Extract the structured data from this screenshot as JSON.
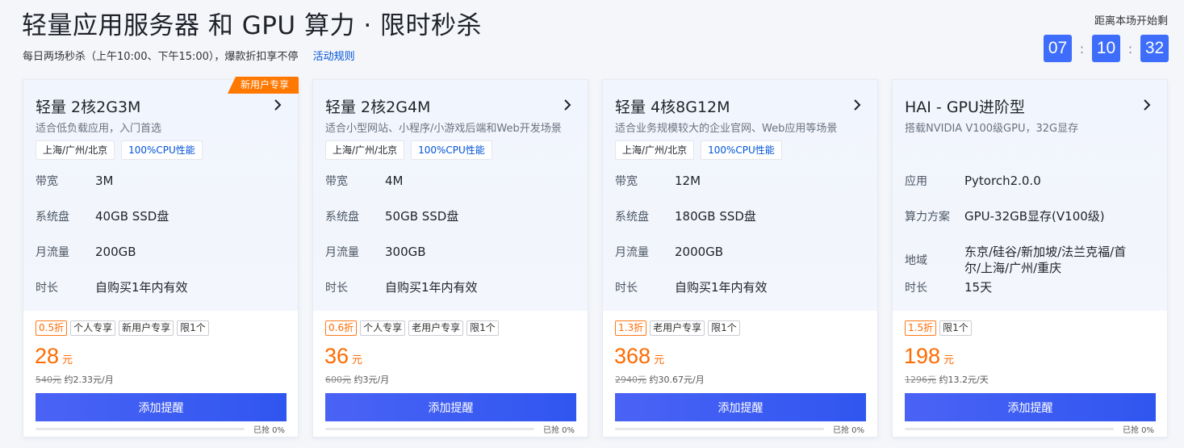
{
  "header": {
    "title": "轻量应用服务器 和 GPU 算力 · 限时秒杀",
    "subtitle": "每日两场秒杀（上午10:00、下午15:00），爆款折扣享不停",
    "rules_link": "活动规则"
  },
  "countdown": {
    "label": "距离本场开始剩",
    "hours": "07",
    "minutes": "10",
    "seconds": "32",
    "separator": ":",
    "accent_color": "#3d6dfa"
  },
  "cards": [
    {
      "badge": "新用户专享",
      "title": "轻量 2核2G3M",
      "desc": "适合低负载应用，入门首选",
      "tags": [
        "上海/广州/北京",
        "100%CPU性能"
      ],
      "specs": [
        {
          "label": "带宽",
          "value": "3M"
        },
        {
          "label": "系统盘",
          "value": "40GB SSD盘"
        },
        {
          "label": "月流量",
          "value": "200GB"
        },
        {
          "label": "时长",
          "value": "自购买1年内有效"
        }
      ],
      "discount": "0.5折",
      "promo_tags": [
        "个人专享",
        "新用户专享",
        "限1个"
      ],
      "price": "28",
      "unit": "元",
      "original_price": "540元",
      "per_period": "约2.33元/月",
      "button": "添加提醒",
      "sold_text": "已抢 0%",
      "sold_fraction": 0
    },
    {
      "badge": "",
      "title": "轻量 2核2G4M",
      "desc": "适合小型网站、小程序/小游戏后端和Web开发场景",
      "tags": [
        "上海/广州/北京",
        "100%CPU性能"
      ],
      "specs": [
        {
          "label": "带宽",
          "value": "4M"
        },
        {
          "label": "系统盘",
          "value": "50GB SSD盘"
        },
        {
          "label": "月流量",
          "value": "300GB"
        },
        {
          "label": "时长",
          "value": "自购买1年内有效"
        }
      ],
      "discount": "0.6折",
      "promo_tags": [
        "个人专享",
        "老用户专享",
        "限1个"
      ],
      "price": "36",
      "unit": "元",
      "original_price": "600元",
      "per_period": "约3元/月",
      "button": "添加提醒",
      "sold_text": "已抢 0%",
      "sold_fraction": 0
    },
    {
      "badge": "",
      "title": "轻量 4核8G12M",
      "desc": "适合业务规模较大的企业官网、Web应用等场景",
      "tags": [
        "上海/广州/北京",
        "100%CPU性能"
      ],
      "specs": [
        {
          "label": "带宽",
          "value": "12M"
        },
        {
          "label": "系统盘",
          "value": "180GB SSD盘"
        },
        {
          "label": "月流量",
          "value": "2000GB"
        },
        {
          "label": "时长",
          "value": "自购买1年内有效"
        }
      ],
      "discount": "1.3折",
      "promo_tags": [
        "老用户专享",
        "限1个"
      ],
      "price": "368",
      "unit": "元",
      "original_price": "2940元",
      "per_period": "约30.67元/月",
      "button": "添加提醒",
      "sold_text": "已抢 0%",
      "sold_fraction": 0
    },
    {
      "badge": "",
      "title": "HAI - GPU进阶型",
      "desc": "搭载NVIDIA V100级GPU，32G显存",
      "tags": [],
      "specs": [
        {
          "label": "应用",
          "value": "Pytorch2.0.0"
        },
        {
          "label": "算力方案",
          "value": "GPU-32GB显存(V100级)"
        },
        {
          "label": "地域",
          "value": "东京/硅谷/新加坡/法兰克福/首尔/上海/广州/重庆"
        },
        {
          "label": "时长",
          "value": "15天"
        }
      ],
      "discount": "1.5折",
      "promo_tags": [
        "限1个"
      ],
      "price": "198",
      "unit": "元",
      "original_price": "1296元",
      "per_period": "约13.2元/天",
      "button": "添加提醒",
      "sold_text": "已抢 0%",
      "sold_fraction": 0
    }
  ]
}
